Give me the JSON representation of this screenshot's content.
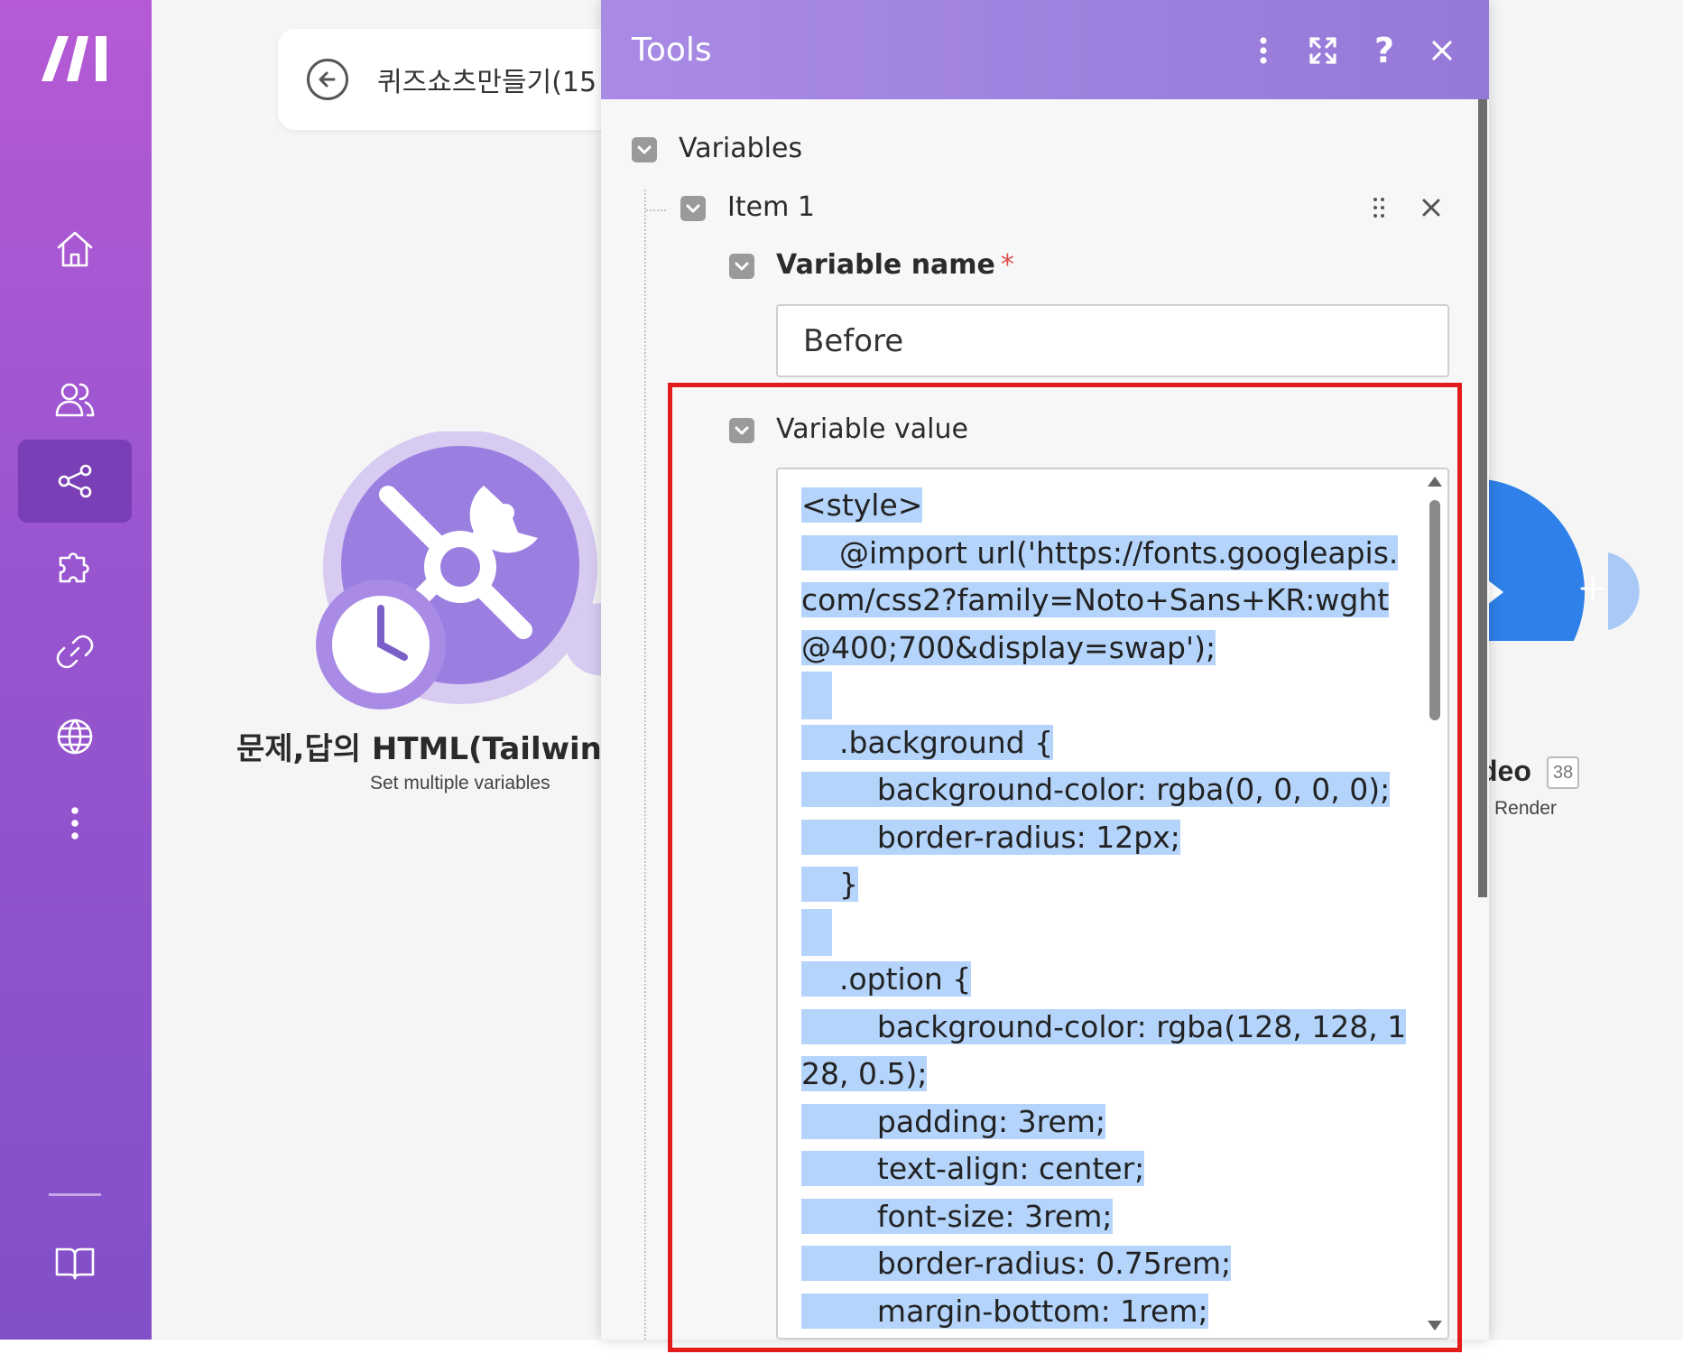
{
  "sidebar": {
    "items": [
      {
        "name": "home",
        "icon": "home-icon"
      },
      {
        "name": "team",
        "icon": "users-icon"
      },
      {
        "name": "scenarios",
        "icon": "share-icon",
        "active": true
      },
      {
        "name": "apps",
        "icon": "puzzle-icon"
      },
      {
        "name": "connections",
        "icon": "link-icon"
      },
      {
        "name": "webhooks",
        "icon": "globe-icon"
      },
      {
        "name": "more",
        "icon": "more-vertical-icon"
      },
      {
        "name": "docs",
        "icon": "book-icon"
      }
    ]
  },
  "canvas": {
    "scenario_title": "퀴즈쇼츠만들기(15",
    "module": {
      "title": "문제,답의 HTML(Tailwind",
      "subtitle": "Set multiple variables"
    },
    "video_module": {
      "title": "deo",
      "badge": "38",
      "subtitle": "Render"
    }
  },
  "panel": {
    "title": "Tools",
    "variables_label": "Variables",
    "item_label": "Item 1",
    "variable_name_label": "Variable name",
    "required_mark": "*",
    "variable_name_value": "Before",
    "variable_value_label": "Variable value",
    "code_lines": [
      "<style>",
      "    @import url('https://fonts.googleapis.",
      "com/css2?family=Noto+Sans+KR:wght",
      "@400;700&display=swap');",
      "",
      "    .background {",
      "        background-color: rgba(0, 0, 0, 0);",
      "        border-radius: 12px;",
      "    }",
      "",
      "    .option {",
      "        background-color: rgba(128, 128, 1",
      "28, 0.5);",
      "        padding: 3rem;",
      "        text-align: center;",
      "        font-size: 3rem;",
      "        border-radius: 0.75rem;",
      "        margin-bottom: 1rem;"
    ]
  },
  "colors": {
    "sidebar_top": "#b55ad4",
    "sidebar_bottom": "#8250c8",
    "panel_header": "#a98be6",
    "selection": "#b4d4fb",
    "highlight_frame": "#e21b1b",
    "tools_module": "#9b7fe0",
    "video_module": "#2f80e8"
  }
}
